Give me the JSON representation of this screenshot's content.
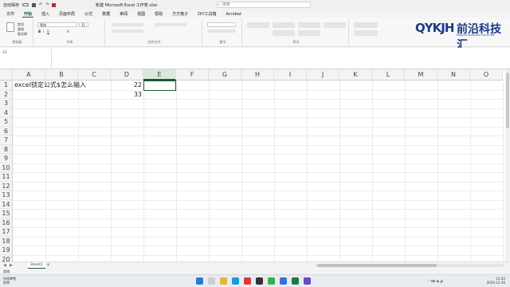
{
  "titlebar": {
    "autosave": "自动保存",
    "title": "新建 Microsoft Excel 工作表.xlsx",
    "search_placeholder": "搜索"
  },
  "menu": [
    "文件",
    "开始",
    "插入",
    "页面布局",
    "公式",
    "数据",
    "审阅",
    "视图",
    "帮助",
    "方方格子",
    "DIY工具箱",
    "Acrobat"
  ],
  "menu_active_index": 1,
  "ribbon": {
    "clipboard_label": "剪贴板",
    "cut": "剪切",
    "copy": "复制",
    "format_painter": "格式刷",
    "font_name": "等线",
    "font_size": "11",
    "font_label": "字体",
    "align_label": "对齐方式",
    "number_label": "数字",
    "styles_label": "样式",
    "cells_label": "单元格"
  },
  "logo": {
    "brand": "QYKJH",
    "brand_cn": "前沿科技汇",
    "tagline": "FRONTIER TECHNOLOGY COLLECTION"
  },
  "formula": {
    "name_box": "E1"
  },
  "grid": {
    "columns": [
      "A",
      "B",
      "C",
      "D",
      "E",
      "F",
      "G",
      "H",
      "I",
      "J",
      "K",
      "L",
      "M",
      "N",
      "O"
    ],
    "rows": [
      "1",
      "2",
      "3",
      "4",
      "5",
      "6",
      "7",
      "8",
      "9",
      "10",
      "11",
      "12",
      "13",
      "14",
      "15",
      "16",
      "17",
      "18",
      "19",
      "20"
    ],
    "a1": "excel锁定公式$怎么输入",
    "d1": "22",
    "d2": "33"
  },
  "sheets": {
    "active": "Sheet1",
    "add": "+"
  },
  "status": {
    "text": "就绪"
  },
  "taskbar": {
    "weather_line1": "持续降雪",
    "weather_line2": "即将",
    "time": "23:32",
    "date": "2024-12-30"
  },
  "colors": {
    "accent": "#185c37",
    "brand": "#1b3a8a"
  }
}
